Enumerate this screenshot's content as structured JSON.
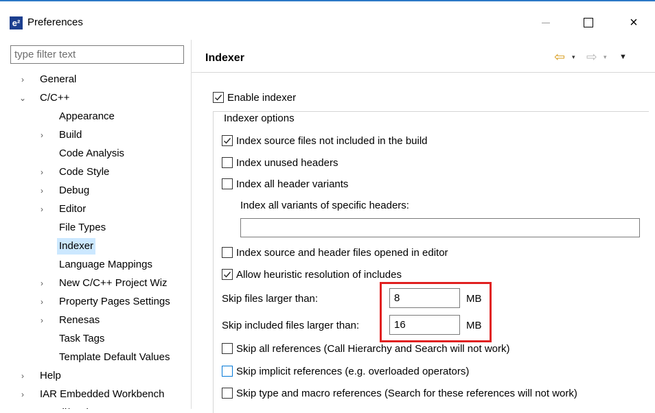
{
  "window": {
    "title": "Preferences",
    "icon": "e²",
    "close_glyph": "×"
  },
  "filter": {
    "placeholder": "type filter text"
  },
  "tree": [
    {
      "label": "General",
      "chevron": "›",
      "level": 0
    },
    {
      "label": "C/C++",
      "chevron": "⌄",
      "level": 0
    },
    {
      "label": "Appearance",
      "chevron": "",
      "level": 1
    },
    {
      "label": "Build",
      "chevron": "›",
      "level": 1
    },
    {
      "label": "Code Analysis",
      "chevron": "",
      "level": 1
    },
    {
      "label": "Code Style",
      "chevron": "›",
      "level": 1
    },
    {
      "label": "Debug",
      "chevron": "›",
      "level": 1
    },
    {
      "label": "Editor",
      "chevron": "›",
      "level": 1
    },
    {
      "label": "File Types",
      "chevron": "",
      "level": 1
    },
    {
      "label": "Indexer",
      "chevron": "",
      "level": 1,
      "selected": true
    },
    {
      "label": "Language Mappings",
      "chevron": "",
      "level": 1
    },
    {
      "label": "New C/C++ Project Wiz",
      "chevron": "›",
      "level": 1
    },
    {
      "label": "Property Pages Settings",
      "chevron": "›",
      "level": 1
    },
    {
      "label": "Renesas",
      "chevron": "›",
      "level": 1
    },
    {
      "label": "Task Tags",
      "chevron": "",
      "level": 1
    },
    {
      "label": "Template Default Values",
      "chevron": "",
      "level": 1
    },
    {
      "label": "Help",
      "chevron": "›",
      "level": 0
    },
    {
      "label": "IAR Embedded Workbench",
      "chevron": "›",
      "level": 0
    },
    {
      "label": "Install/Update",
      "chevron": "›",
      "level": 0
    }
  ],
  "panel": {
    "title": "Indexer",
    "nav": {
      "back": "⇦",
      "forward": "⇨",
      "dropdown": "▾",
      "menu": "▼"
    }
  },
  "options": {
    "enable_indexer": {
      "label": "Enable indexer",
      "checked": true
    },
    "group_title": "Indexer options",
    "index_source_not_in_build": {
      "label": "Index source files not included in the build",
      "checked": true
    },
    "index_unused_headers": {
      "label": "Index unused headers",
      "checked": false
    },
    "index_all_header_variants": {
      "label": "Index all header variants",
      "checked": false
    },
    "specific_headers_label": "Index all variants of specific headers:",
    "specific_headers_value": "",
    "index_opened_in_editor": {
      "label": "Index source and header files opened in editor",
      "checked": false
    },
    "heuristic_includes": {
      "label": "Allow heuristic resolution of includes",
      "checked": true
    },
    "skip_files_larger": {
      "label": "Skip files larger than:",
      "value": "8",
      "unit": "MB"
    },
    "skip_included_larger": {
      "label": "Skip included files larger than:",
      "value": "16",
      "unit": "MB"
    },
    "skip_all_references": {
      "label": "Skip all references (Call Hierarchy and Search will not work)",
      "checked": false
    },
    "skip_implicit_references": {
      "label": "Skip implicit references (e.g. overloaded operators)",
      "checked": false
    },
    "skip_type_macro_references": {
      "label": "Skip type and macro references (Search for these references will not work)",
      "checked": false
    }
  },
  "colors": {
    "selection": "#cce8ff",
    "highlight_box": "#e02020",
    "back_arrow": "#d89b1a",
    "focus_border": "#0078d7"
  }
}
